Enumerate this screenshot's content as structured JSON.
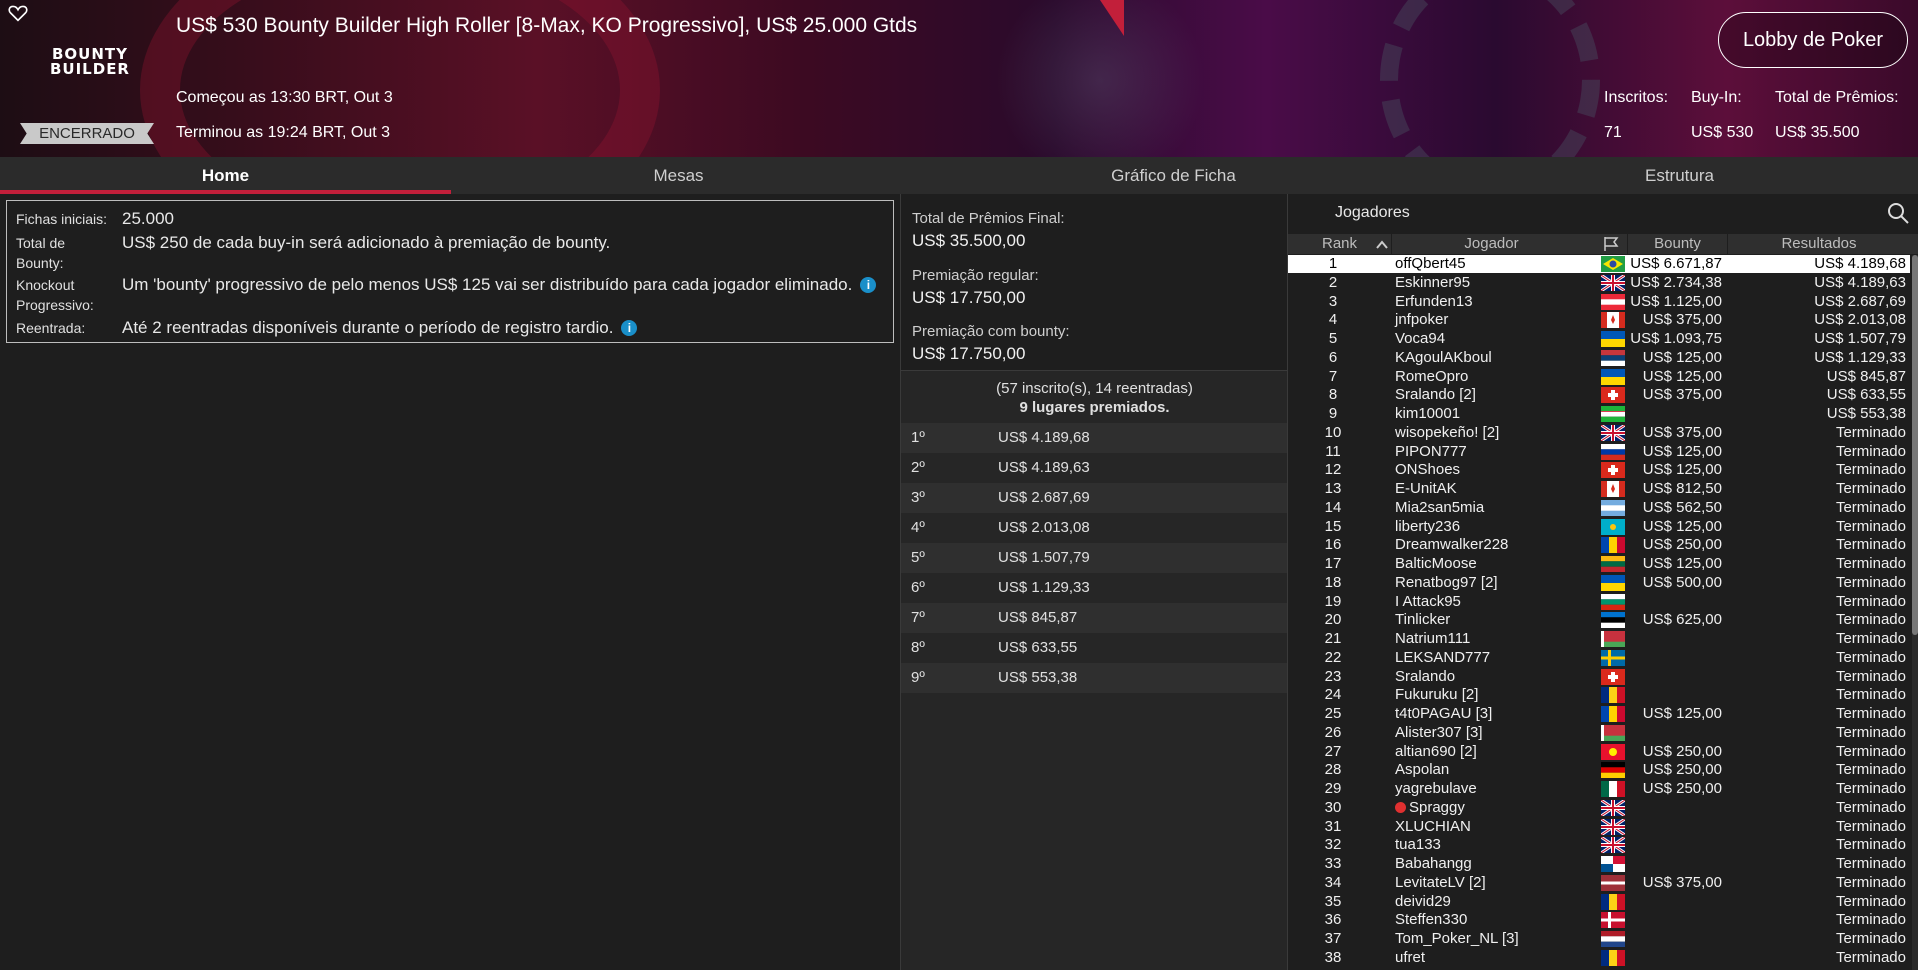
{
  "header": {
    "title": "US$ 530 Bounty Builder High Roller [8-Max, KO Progressivo], US$ 25.000 Gtds",
    "logo_line1": "BOUNTY",
    "logo_line2": "BUILDER",
    "status": "ENCERRADO",
    "started": "Começou as 13:30 BRT, Out 3",
    "ended": "Terminou as 19:24 BRT, Out 3",
    "lobby_button": "Lobby de Poker",
    "stats": {
      "entrants_label": "Inscritos:",
      "entrants": "71",
      "buyin_label": "Buy-In:",
      "buyin": "US$ 530",
      "prizes_label": "Total de Prêmios:",
      "prizes": "US$ 35.500"
    }
  },
  "tabs": [
    {
      "label": "Home",
      "active": true
    },
    {
      "label": "Mesas"
    },
    {
      "label": "Gráfico de Ficha"
    },
    {
      "label": "Estrutura"
    }
  ],
  "info": {
    "chips_label": "Fichas iniciais:",
    "chips": "25.000",
    "bounty_label_1": "Total de",
    "bounty_label_2": "Bounty:",
    "bounty": "US$ 250 de cada buy-in será adicionado à premiação de bounty.",
    "ko_label_1": "Knockout",
    "ko_label_2": "Progressivo:",
    "ko": "Um 'bounty' progressivo de pelo menos US$ 125 vai ser distribuído para cada jogador eliminado.",
    "reentry_label": "Reentrada:",
    "reentry": "Até 2 reentradas disponíveis durante o período de registro tardio.",
    "info_icon": "i"
  },
  "prizes": {
    "final_label": "Total de Prêmios Final:",
    "final": "US$ 35.500,00",
    "regular_label": "Premiação regular:",
    "regular": "US$ 17.750,00",
    "bounty_label": "Premiação com bounty:",
    "bounty": "US$ 17.750,00",
    "entries_info": "(57 inscrito(s), 14 reentradas)",
    "places_info": "9 lugares premiados.",
    "payouts": [
      {
        "pos": "1º",
        "amt": "US$ 4.189,68"
      },
      {
        "pos": "2º",
        "amt": "US$ 4.189,63"
      },
      {
        "pos": "3º",
        "amt": "US$ 2.687,69"
      },
      {
        "pos": "4º",
        "amt": "US$ 2.013,08"
      },
      {
        "pos": "5º",
        "amt": "US$ 1.507,79"
      },
      {
        "pos": "6º",
        "amt": "US$ 1.129,33"
      },
      {
        "pos": "7º",
        "amt": "US$ 845,87"
      },
      {
        "pos": "8º",
        "amt": "US$ 633,55"
      },
      {
        "pos": "9º",
        "amt": "US$ 553,38"
      }
    ]
  },
  "players": {
    "title": "Jogadores",
    "columns": {
      "rank": "Rank",
      "player": "Jogador",
      "bounty": "Bounty",
      "results": "Resultados"
    },
    "rows": [
      {
        "rank": "1",
        "name": "offQbert45",
        "flag": "br",
        "bounty": "US$ 6.671,87",
        "result": "US$ 4.189,68"
      },
      {
        "rank": "2",
        "name": "Eskinner95",
        "flag": "gb",
        "bounty": "US$ 2.734,38",
        "result": "US$ 4.189,63"
      },
      {
        "rank": "3",
        "name": "Erfunden13",
        "flag": "at",
        "bounty": "US$ 1.125,00",
        "result": "US$ 2.687,69"
      },
      {
        "rank": "4",
        "name": "jnfpoker",
        "flag": "ca",
        "bounty": "US$ 375,00",
        "result": "US$ 2.013,08"
      },
      {
        "rank": "5",
        "name": "Voca94",
        "flag": "ua",
        "bounty": "US$ 1.093,75",
        "result": "US$ 1.507,79"
      },
      {
        "rank": "6",
        "name": "KAgoulAKboul",
        "flag": "rs",
        "bounty": "US$ 125,00",
        "result": "US$ 1.129,33"
      },
      {
        "rank": "7",
        "name": "RomeOpro",
        "flag": "ua",
        "bounty": "US$ 125,00",
        "result": "US$ 845,87"
      },
      {
        "rank": "8",
        "name": "Sralando [2]",
        "flag": "ch",
        "bounty": "US$ 375,00",
        "result": "US$ 633,55"
      },
      {
        "rank": "9",
        "name": "kim10001",
        "flag": "uz",
        "bounty": "",
        "result": "US$ 553,38"
      },
      {
        "rank": "10",
        "name": "wisopekeño! [2]",
        "flag": "gb",
        "bounty": "US$ 375,00",
        "result": "Terminado"
      },
      {
        "rank": "11",
        "name": "PIPON777",
        "flag": "ru",
        "bounty": "US$ 125,00",
        "result": "Terminado"
      },
      {
        "rank": "12",
        "name": "ONShoes",
        "flag": "ch",
        "bounty": "US$ 125,00",
        "result": "Terminado"
      },
      {
        "rank": "13",
        "name": "E-UnitAK",
        "flag": "ca",
        "bounty": "US$ 812,50",
        "result": "Terminado"
      },
      {
        "rank": "14",
        "name": "Mia2san5mia",
        "flag": "ar",
        "bounty": "US$ 562,50",
        "result": "Terminado"
      },
      {
        "rank": "15",
        "name": "liberty236",
        "flag": "kz",
        "bounty": "US$ 125,00",
        "result": "Terminado"
      },
      {
        "rank": "16",
        "name": "Dreamwalker228",
        "flag": "md",
        "bounty": "US$ 250,00",
        "result": "Terminado"
      },
      {
        "rank": "17",
        "name": "BalticMoose",
        "flag": "lt",
        "bounty": "US$ 125,00",
        "result": "Terminado"
      },
      {
        "rank": "18",
        "name": "Renatbog97 [2]",
        "flag": "ua",
        "bounty": "US$ 500,00",
        "result": "Terminado"
      },
      {
        "rank": "19",
        "name": "I Attack95",
        "flag": "bg",
        "bounty": "",
        "result": "Terminado"
      },
      {
        "rank": "20",
        "name": "Tinlicker",
        "flag": "ee",
        "bounty": "US$ 625,00",
        "result": "Terminado"
      },
      {
        "rank": "21",
        "name": "Natrium111",
        "flag": "by",
        "bounty": "",
        "result": "Terminado"
      },
      {
        "rank": "22",
        "name": "LEKSAND777",
        "flag": "se",
        "bounty": "",
        "result": "Terminado"
      },
      {
        "rank": "23",
        "name": "Sralando",
        "flag": "ch",
        "bounty": "",
        "result": "Terminado"
      },
      {
        "rank": "24",
        "name": "Fukuruku [2]",
        "flag": "ro",
        "bounty": "",
        "result": "Terminado"
      },
      {
        "rank": "25",
        "name": "t4t0PAGAU [3]",
        "flag": "md",
        "bounty": "US$ 125,00",
        "result": "Terminado"
      },
      {
        "rank": "26",
        "name": "Alister307 [3]",
        "flag": "by",
        "bounty": "",
        "result": "Terminado"
      },
      {
        "rank": "27",
        "name": "altian690 [2]",
        "flag": "kg",
        "bounty": "US$ 250,00",
        "result": "Terminado"
      },
      {
        "rank": "28",
        "name": "Aspolan",
        "flag": "de",
        "bounty": "US$ 250,00",
        "result": "Terminado"
      },
      {
        "rank": "29",
        "name": "yagrebulave",
        "flag": "mx",
        "bounty": "US$ 250,00",
        "result": "Terminado"
      },
      {
        "rank": "30",
        "name": "Spraggy",
        "flag": "gb",
        "bounty": "",
        "result": "Terminado",
        "badge": true
      },
      {
        "rank": "31",
        "name": "XLUCHIAN",
        "flag": "gb",
        "bounty": "",
        "result": "Terminado"
      },
      {
        "rank": "32",
        "name": "tua133",
        "flag": "gb",
        "bounty": "",
        "result": "Terminado"
      },
      {
        "rank": "33",
        "name": "Babahangg",
        "flag": "pa",
        "bounty": "",
        "result": "Terminado"
      },
      {
        "rank": "34",
        "name": "LevitateLV [2]",
        "flag": "lv",
        "bounty": "US$ 375,00",
        "result": "Terminado"
      },
      {
        "rank": "35",
        "name": "deivid29",
        "flag": "ro",
        "bounty": "",
        "result": "Terminado"
      },
      {
        "rank": "36",
        "name": "Steffen330",
        "flag": "dk",
        "bounty": "",
        "result": "Terminado"
      },
      {
        "rank": "37",
        "name": "Tom_Poker_NL [3]",
        "flag": "nl",
        "bounty": "",
        "result": "Terminado"
      },
      {
        "rank": "38",
        "name": "ufret",
        "flag": "ro",
        "bounty": "",
        "result": "Terminado"
      }
    ]
  },
  "colors": {
    "accent": "#c21f3a",
    "info_icon": "#1a8fc9"
  }
}
